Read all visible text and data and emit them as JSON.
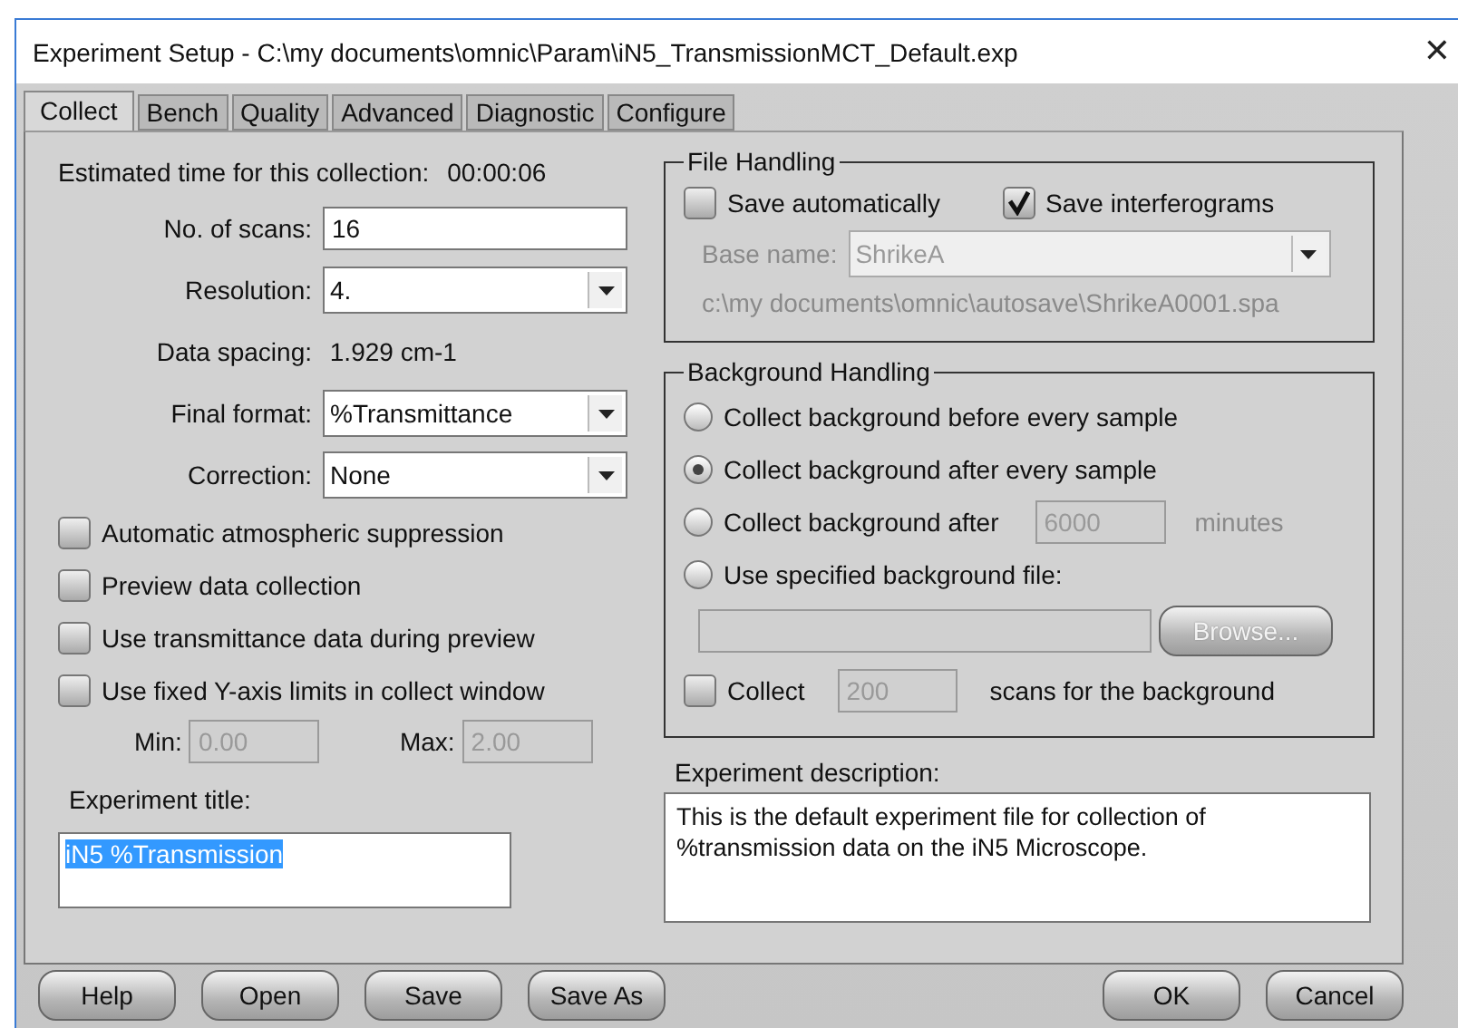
{
  "window": {
    "title": "Experiment Setup - C:\\my documents\\omnic\\Param\\iN5_TransmissionMCT_Default.exp",
    "close": "✕"
  },
  "tabs": [
    {
      "label": "Collect",
      "selected": true
    },
    {
      "label": "Bench",
      "selected": false
    },
    {
      "label": "Quality",
      "selected": false
    },
    {
      "label": "Advanced",
      "selected": false
    },
    {
      "label": "Diagnostic",
      "selected": false
    },
    {
      "label": "Configure",
      "selected": false
    }
  ],
  "estimated_time": {
    "label": "Estimated time for this collection:",
    "value": "00:00:06"
  },
  "fields": [
    {
      "kind": "input",
      "label": "No. of scans:",
      "value": "16"
    },
    {
      "kind": "select",
      "label": "Resolution:",
      "value": "4."
    },
    {
      "kind": "readout",
      "label": "Data spacing:",
      "value": "1.929 cm-1"
    },
    {
      "kind": "select",
      "label": "Final format:",
      "value": "%Transmittance"
    },
    {
      "kind": "select",
      "label": "Correction:",
      "value": "None"
    }
  ],
  "options": [
    {
      "label": "Automatic atmospheric suppression",
      "checked": false
    },
    {
      "label": "Preview data collection",
      "checked": false
    },
    {
      "label": "Use transmittance data during preview",
      "checked": false
    },
    {
      "label": "Use fixed Y-axis limits in collect window",
      "checked": false
    }
  ],
  "y_limits": {
    "min_label": "Min:",
    "min_value": "0.00",
    "max_label": "Max:",
    "max_value": "2.00",
    "disabled": true
  },
  "experiment_title": {
    "label": "Experiment title:",
    "value": "iN5 %Transmission",
    "selected": true
  },
  "file_handling": {
    "title": "File Handling",
    "save_automatically": {
      "label": "Save automatically",
      "checked": false
    },
    "save_interferograms": {
      "label": "Save interferograms",
      "checked": true
    },
    "base_name": {
      "label": "Base name:",
      "value": "ShrikeA",
      "disabled": true
    },
    "path": "c:\\my documents\\omnic\\autosave\\ShrikeA0001.spa"
  },
  "background_handling": {
    "title": "Background Handling",
    "choices": [
      {
        "kind": "plain",
        "label": "Collect background before every sample",
        "selected": false
      },
      {
        "kind": "plain",
        "label": "Collect background after every sample",
        "selected": true
      },
      {
        "kind": "minutes",
        "label": "Collect background after",
        "value": "6000",
        "unit": "minutes",
        "selected": false
      },
      {
        "kind": "file",
        "label": "Use specified background file:",
        "selected": false
      }
    ],
    "browse": {
      "label": "Browse...",
      "disabled": true
    },
    "collect": {
      "label": "Collect",
      "checked": false,
      "value": "200",
      "suffix": "scans for the background"
    }
  },
  "description": {
    "label": "Experiment description:",
    "text": "This is the default experiment file for collection of %transmission data on the iN5 Microscope."
  },
  "buttons_left": [
    "Help",
    "Open",
    "Save",
    "Save As"
  ],
  "buttons_right": [
    "OK",
    "Cancel"
  ]
}
